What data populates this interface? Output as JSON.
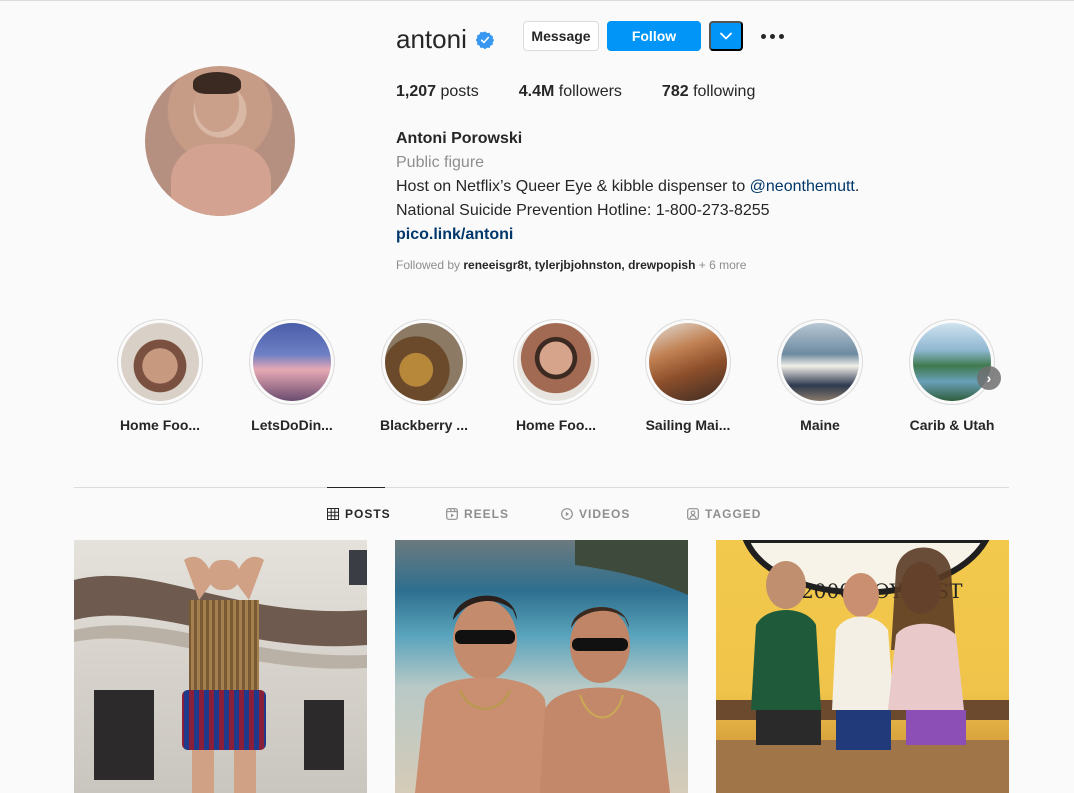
{
  "profile": {
    "username": "antoni",
    "verified": true,
    "message_label": "Message",
    "follow_label": "Follow",
    "dropdown_icon": "chevron-down-icon",
    "more_icon": "more-options-icon",
    "stats": {
      "posts_count": "1,207",
      "posts_label": "posts",
      "followers_count": "4.4M",
      "followers_label": "followers",
      "following_count": "782",
      "following_label": "following"
    },
    "full_name": "Antoni Porowski",
    "category": "Public figure",
    "bio_line1_text": "Host on Netflix’s Queer Eye & kibble dispenser to ",
    "bio_line1_mention": "@neonthemutt",
    "bio_line1_end": ".",
    "bio_line2": "National Suicide Prevention Hotline: 1-800-273-8255",
    "link": "pico.link/antoni",
    "followed_by_prefix": "Followed by ",
    "followed_by_users": "reneeisgr8t, tylerjbjohnston, drewpopish",
    "followed_by_more": " + 6 more"
  },
  "highlights": [
    {
      "label": "Home Foo..."
    },
    {
      "label": "LetsDoDin..."
    },
    {
      "label": "Blackberry ..."
    },
    {
      "label": "Home Foo..."
    },
    {
      "label": "Sailing Mai..."
    },
    {
      "label": "Maine"
    },
    {
      "label": "Carib & Utah"
    }
  ],
  "tabs": [
    {
      "label": "POSTS",
      "icon": "grid-icon",
      "active": true
    },
    {
      "label": "REELS",
      "icon": "reels-icon",
      "active": false
    },
    {
      "label": "VIDEOS",
      "icon": "play-icon",
      "active": false
    },
    {
      "label": "TAGGED",
      "icon": "tagged-icon",
      "active": false
    }
  ],
  "colors": {
    "accent": "#0095f6",
    "link": "#00376b",
    "muted": "#8e8e8e",
    "text": "#262626",
    "border": "#dbdbdb",
    "background": "#fafafa"
  }
}
